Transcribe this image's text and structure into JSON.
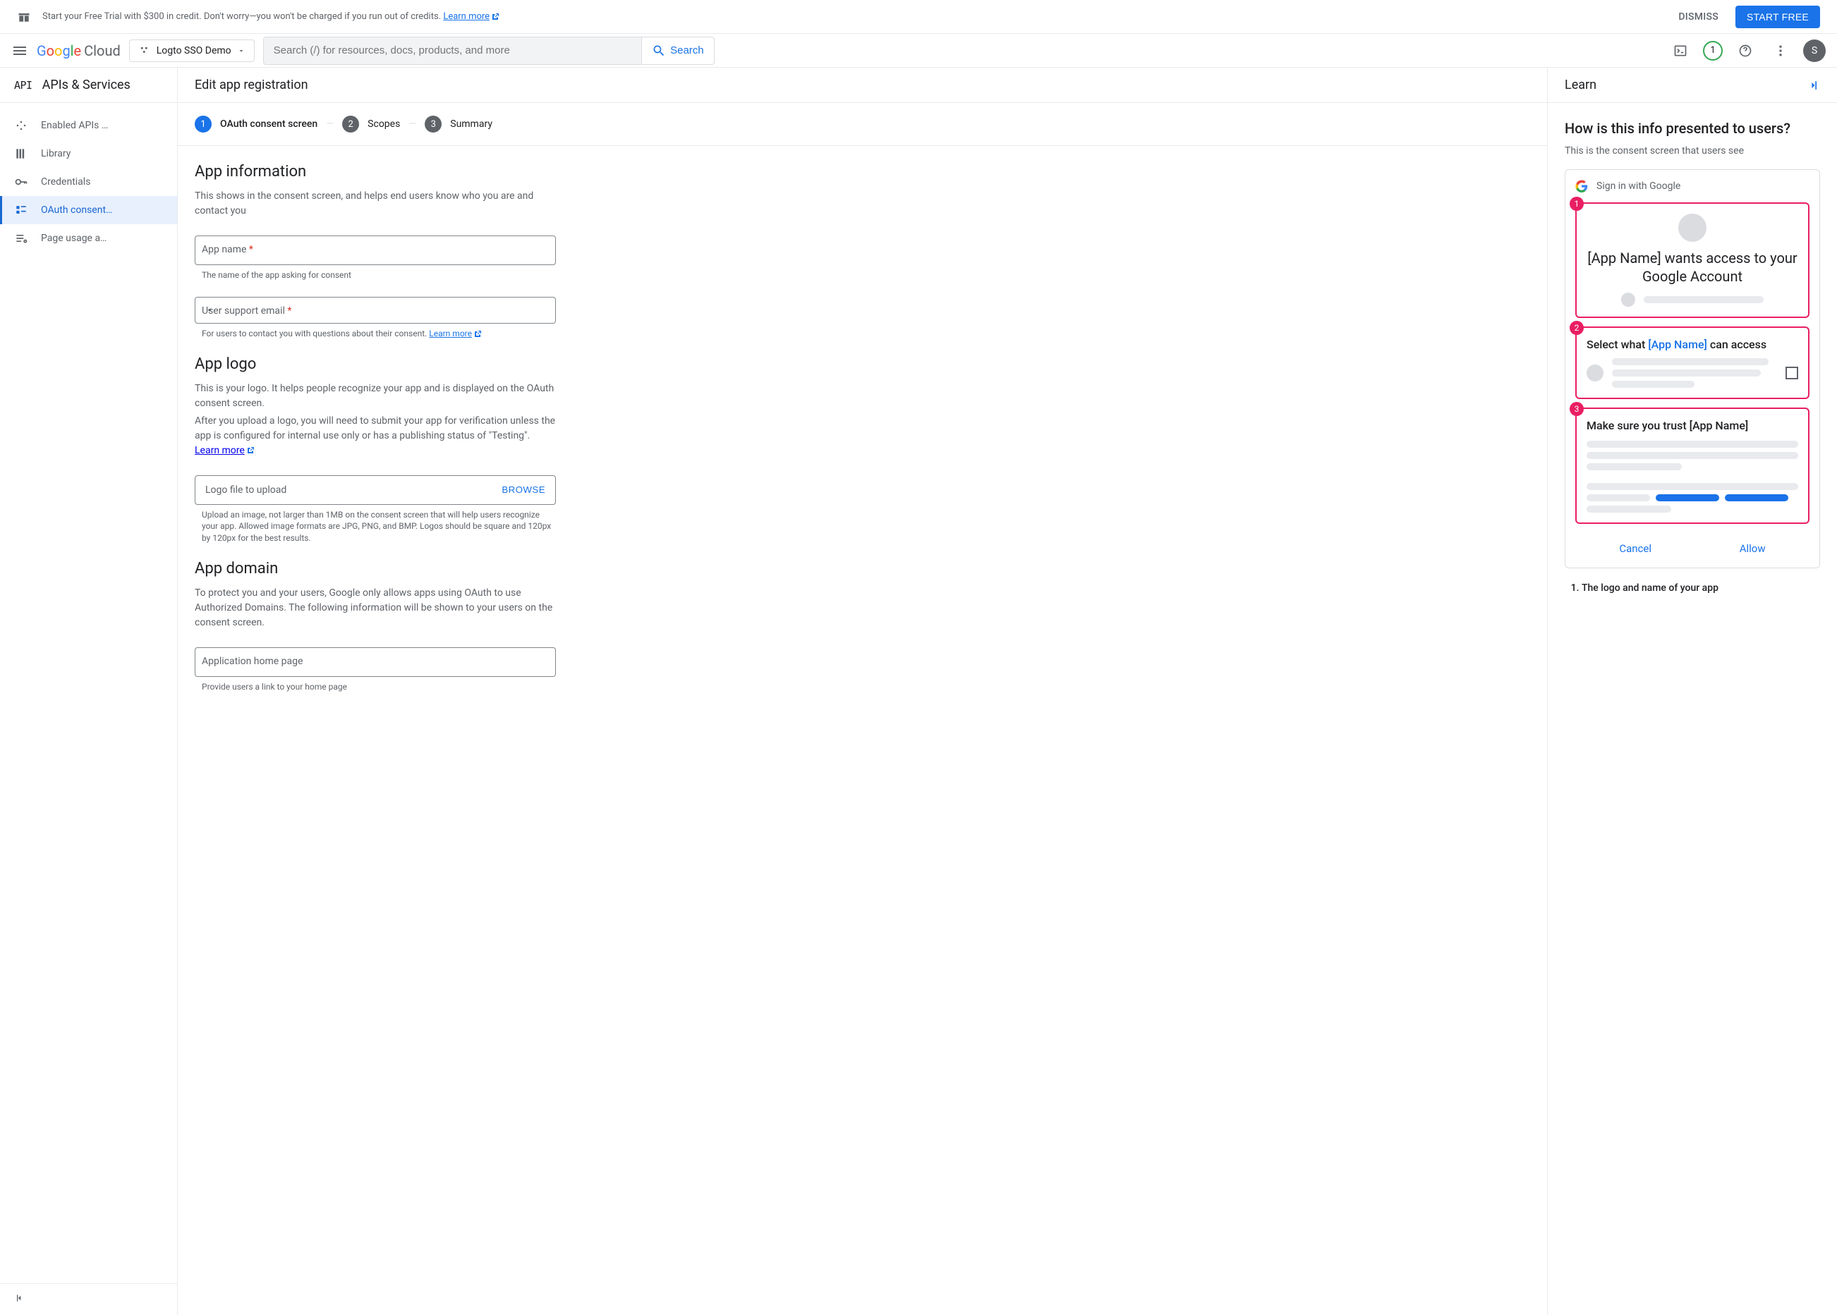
{
  "banner": {
    "text": "Start your Free Trial with $300 in credit. Don't worry—you won't be charged if you run out of credits. ",
    "learn_more": "Learn more",
    "dismiss": "DISMISS",
    "cta": "START FREE"
  },
  "header": {
    "logo_text": "Cloud",
    "project": "Logto SSO Demo",
    "search_placeholder": "Search (/) for resources, docs, products, and more",
    "search_btn": "Search",
    "trial_count": "1",
    "avatar_initial": "S"
  },
  "sidebar": {
    "title": "APIs & Services",
    "api_label": "API",
    "items": [
      {
        "label": "Enabled APIs …"
      },
      {
        "label": "Library"
      },
      {
        "label": "Credentials"
      },
      {
        "label": "OAuth consent…"
      },
      {
        "label": "Page usage a…"
      }
    ]
  },
  "content": {
    "title": "Edit app registration",
    "steps": [
      {
        "num": "1",
        "label": "OAuth consent screen"
      },
      {
        "num": "2",
        "label": "Scopes"
      },
      {
        "num": "3",
        "label": "Summary"
      }
    ],
    "app_info": {
      "title": "App information",
      "desc": "This shows in the consent screen, and helps end users know who you are and contact you",
      "name_label": "App name ",
      "name_helper": "The name of the app asking for consent",
      "email_label": "User support email ",
      "email_helper": "For users to contact you with questions about their consent. ",
      "learn_more": "Learn more"
    },
    "app_logo": {
      "title": "App logo",
      "desc1": "This is your logo. It helps people recognize your app and is displayed on the OAuth consent screen.",
      "desc2": "After you upload a logo, you will need to submit your app for verification unless the app is configured for internal use only or has a publishing status of \"Testing\". ",
      "learn_more": "Learn more",
      "upload_label": "Logo file to upload",
      "browse": "BROWSE",
      "upload_helper": "Upload an image, not larger than 1MB on the consent screen that will help users recognize your app. Allowed image formats are JPG, PNG, and BMP. Logos should be square and 120px by 120px for the best results."
    },
    "app_domain": {
      "title": "App domain",
      "desc": "To protect you and your users, Google only allows apps using OAuth to use Authorized Domains. The following information will be shown to your users on the consent screen.",
      "home_label": "Application home page",
      "home_helper": "Provide users a link to your home page"
    }
  },
  "learn": {
    "title": "Learn",
    "heading": "How is this info presented to users?",
    "sub": "This is the consent screen that users see",
    "signin": "Sign in with Google",
    "card1": "[App Name] wants access to your Google Account",
    "card2_pre": "Select what ",
    "card2_app": "[App Name]",
    "card2_post": " can access",
    "card3": "Make sure you trust [App Name]",
    "cancel": "Cancel",
    "allow": "Allow",
    "list_item1": "The logo and name of your app"
  }
}
